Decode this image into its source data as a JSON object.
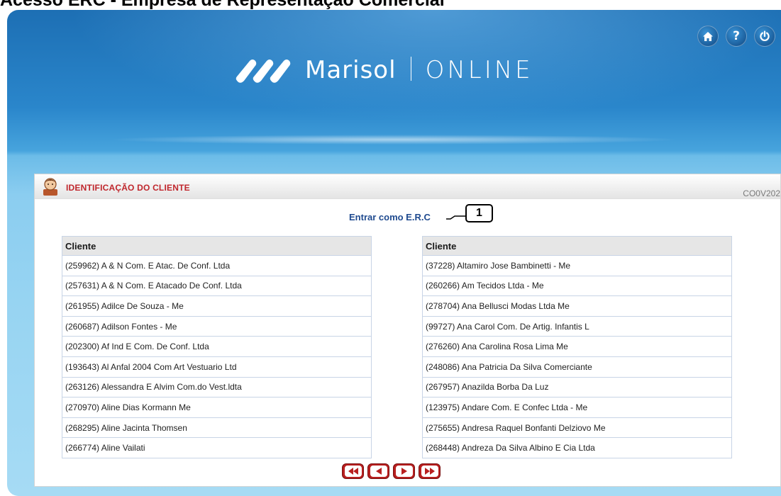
{
  "page_heading": "Acesso ERC - Empresa de Representação Comercial",
  "header": {
    "brand_name": "Marisol",
    "brand_suffix": "ONLINE",
    "icons": [
      "home-icon",
      "help-icon",
      "power-icon"
    ],
    "help_glyph": "?"
  },
  "panel": {
    "title": "IDENTIFICAÇÃO DO CLIENTE",
    "screen_code": "CO0V202",
    "erc_link": "Entrar como E.R.C",
    "callout_number": "1"
  },
  "left_table": {
    "header": "Cliente",
    "rows": [
      "(259962) A & N Com. E Atac. De Conf. Ltda",
      "(257631) A & N Com. E Atacado De Conf. Ltda",
      "(261955) Adilce De Souza - Me",
      "(260687) Adilson Fontes - Me",
      "(202300) Af Ind E Com. De Conf. Ltda",
      "(193643) Al Anfal 2004 Com Art Vestuario Ltd",
      "(263126) Alessandra E Alvim Com.do Vest.ldta",
      "(270970) Aline Dias Kormann Me",
      "(268295) Aline Jacinta Thomsen",
      "(266774) Aline Vailati"
    ]
  },
  "right_table": {
    "header": "Cliente",
    "rows": [
      "(37228) Altamiro Jose Bambinetti - Me",
      "(260266) Am Tecidos Ltda - Me",
      "(278704) Ana Bellusci Modas Ltda Me",
      "(99727) Ana Carol Com. De Artig. Infantis L",
      "(276260) Ana Carolina Rosa Lima Me",
      "(248086) Ana Patricia Da Silva Comerciante",
      "(267957) Anazilda Borba Da Luz",
      "(123975) Andare Com. E Confec Ltda - Me",
      "(275655) Andresa Raquel Bonfanti Delziovo Me",
      "(268448) Andreza Da Silva Albino E Cia Ltda"
    ]
  },
  "pager": {
    "buttons": [
      "first-page-icon",
      "previous-page-icon",
      "next-page-icon",
      "last-page-icon"
    ]
  },
  "colors": {
    "panel_title": "#c0272d",
    "link": "#1f4a8f",
    "pager": "#b81f1f",
    "header_blue": "#2a86cb"
  }
}
